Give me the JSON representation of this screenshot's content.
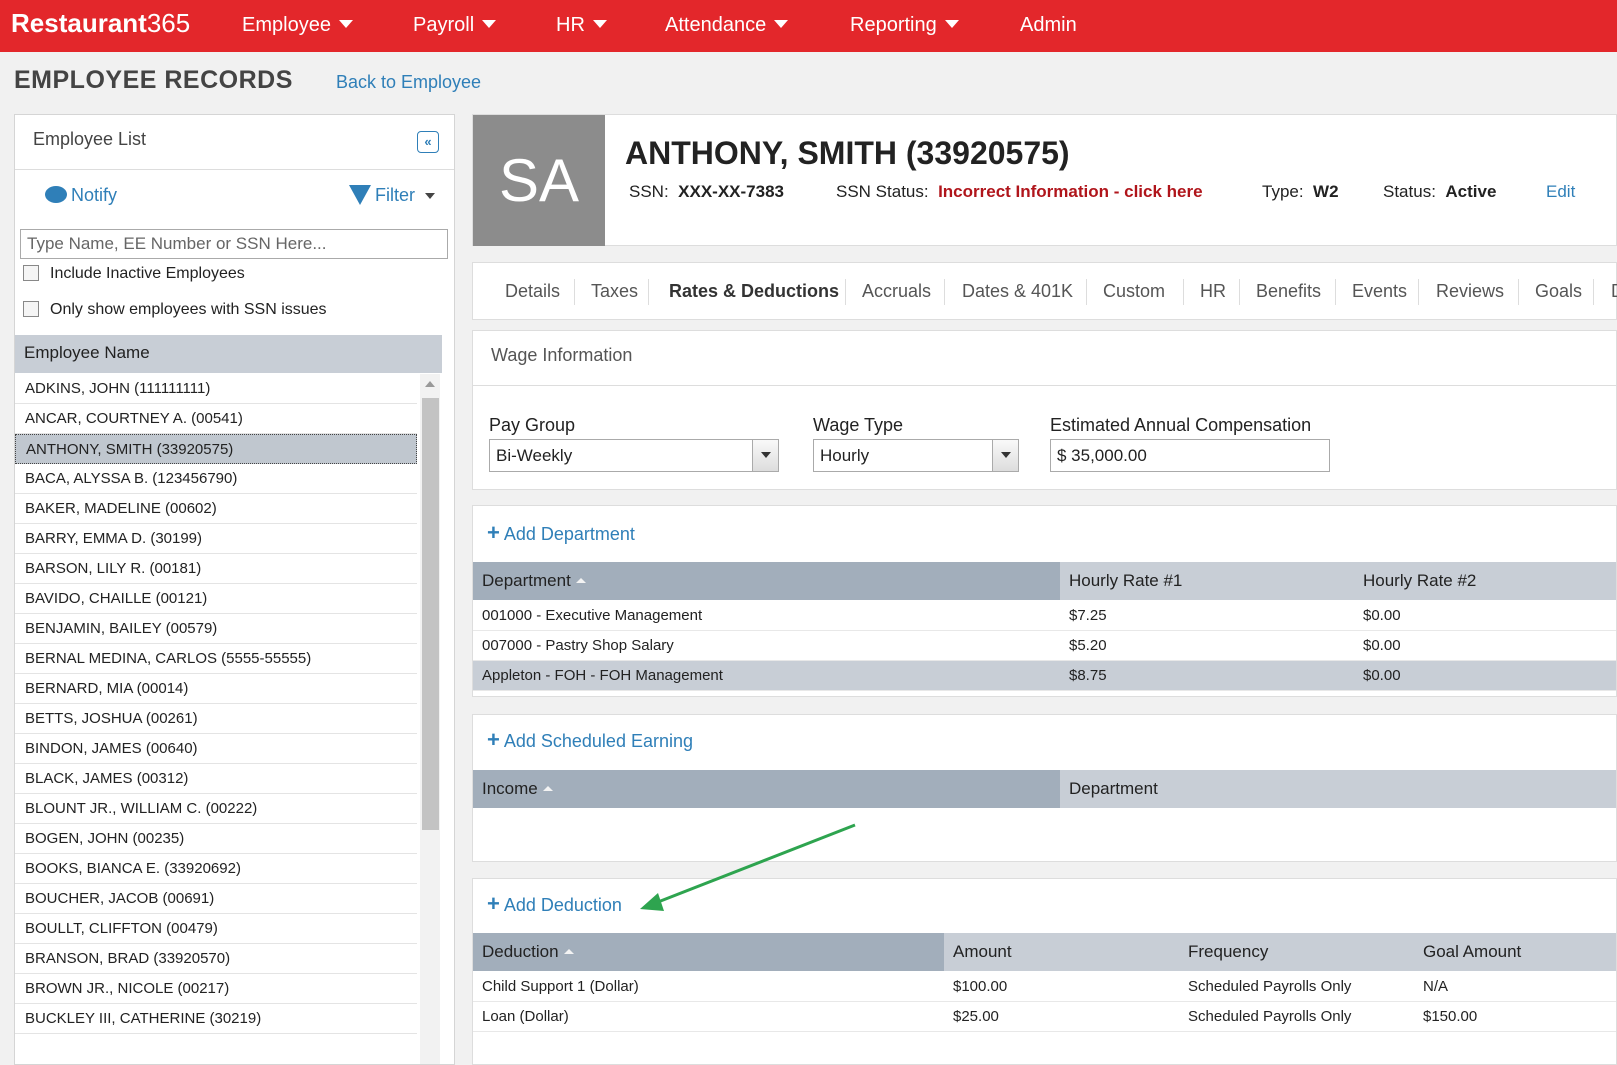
{
  "app": {
    "brand_main": "Restaurant",
    "brand_num": "365"
  },
  "nav": [
    "Employee",
    "Payroll",
    "HR",
    "Attendance",
    "Reporting",
    "Admin"
  ],
  "page": {
    "title": "EMPLOYEE RECORDS",
    "back_link": "Back to Employee"
  },
  "sidebar": {
    "title": "Employee List",
    "collapse_icon": "double-chevron-left-icon",
    "notify": "Notify",
    "filter": "Filter",
    "search_placeholder": "Type Name, EE Number or SSN Here...",
    "include_inactive": "Include Inactive Employees",
    "ssn_issues": "Only show employees with SSN issues",
    "list_header": "Employee Name",
    "employees": [
      "ADKINS, JOHN (111111111)",
      "ANCAR, COURTNEY A. (00541)",
      "ANTHONY, SMITH (33920575)",
      "BACA, ALYSSA B. (123456790)",
      "BAKER, MADELINE (00602)",
      "BARRY, EMMA D. (30199)",
      "BARSON, LILY R. (00181)",
      "BAVIDO, CHAILLE (00121)",
      "BENJAMIN, BAILEY (00579)",
      "BERNAL MEDINA, CARLOS (5555-55555)",
      "BERNARD, MIA (00014)",
      "BETTS, JOSHUA (00261)",
      "BINDON, JAMES (00640)",
      "BLACK, JAMES (00312)",
      "BLOUNT JR., WILLIAM C. (00222)",
      "BOGEN, JOHN (00235)",
      "BOOKS, BIANCA E. (33920692)",
      "BOUCHER, JACOB (00691)",
      "BOULLT, CLIFFTON (00479)",
      "BRANSON, BRAD (33920570)",
      "BROWN JR., NICOLE (00217)",
      "BUCKLEY III, CATHERINE (30219)"
    ],
    "selected_index": 2
  },
  "employee": {
    "initials": "SA",
    "name": "ANTHONY, SMITH (33920575)",
    "ssn_label": "SSN:",
    "ssn": "XXX-XX-7383",
    "ssn_status_label": "SSN Status:",
    "ssn_status": "Incorrect Information - click here",
    "type_label": "Type:",
    "type": "W2",
    "status_label": "Status:",
    "status": "Active",
    "edit": "Edit"
  },
  "tabs": [
    "Details",
    "Taxes",
    "Rates & Deductions",
    "Accruals",
    "Dates & 401K",
    "Custom",
    "HR",
    "Benefits",
    "Events",
    "Reviews",
    "Goals",
    "D"
  ],
  "active_tab": "Rates & Deductions",
  "wage": {
    "title": "Wage Information",
    "pay_group_label": "Pay Group",
    "pay_group": "Bi-Weekly",
    "wage_type_label": "Wage Type",
    "wage_type": "Hourly",
    "comp_label": "Estimated Annual Compensation",
    "comp": "$ 35,000.00"
  },
  "departments": {
    "add": "Add Department",
    "columns": [
      "Department",
      "Hourly Rate #1",
      "Hourly Rate #2"
    ],
    "rows": [
      [
        "001000 - Executive Management",
        "$7.25",
        "$0.00"
      ],
      [
        "007000 - Pastry Shop Salary",
        "$5.20",
        "$0.00"
      ],
      [
        "Appleton - FOH - FOH Management",
        "$8.75",
        "$0.00"
      ]
    ],
    "selected_index": 2
  },
  "earnings": {
    "add": "Add Scheduled Earning",
    "columns": [
      "Income",
      "Department"
    ]
  },
  "deductions": {
    "add": "Add Deduction",
    "columns": [
      "Deduction",
      "Amount",
      "Frequency",
      "Goal Amount"
    ],
    "rows": [
      [
        "Child Support 1 (Dollar)",
        "$100.00",
        "Scheduled Payrolls Only",
        "N/A"
      ],
      [
        "Loan (Dollar)",
        "$25.00",
        "Scheduled Payrolls Only",
        "$150.00"
      ]
    ]
  },
  "colors": {
    "brand": "#e3272b",
    "link": "#2f7fb8",
    "alert": "#b0151b",
    "annotation": "#2ea44f"
  }
}
